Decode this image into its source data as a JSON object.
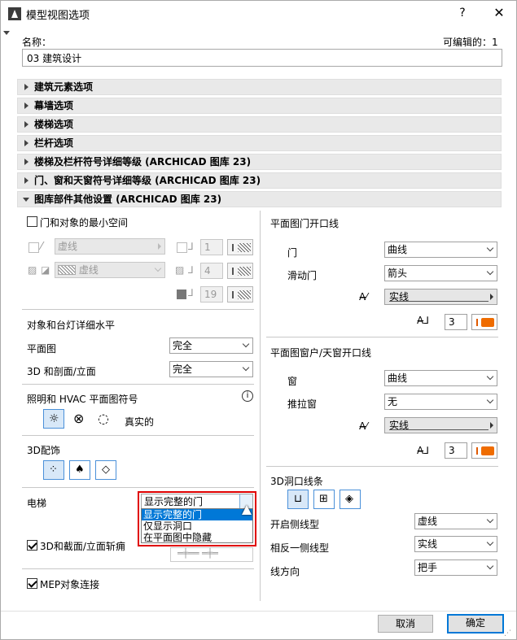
{
  "window": {
    "title": "模型视图选项",
    "help": "?",
    "close": "✕"
  },
  "header": {
    "name_label": "名称：",
    "editable_label": "可编辑的：1",
    "name_value": "03 建筑设计"
  },
  "panels": [
    {
      "label": "建筑元素选项",
      "expanded": false
    },
    {
      "label": "幕墙选项",
      "expanded": false
    },
    {
      "label": "楼梯选项",
      "expanded": false
    },
    {
      "label": "栏杆选项",
      "expanded": false
    },
    {
      "label": "楼梯及栏杆符号详细等级 (ARCHICAD 图库 23)",
      "expanded": false
    },
    {
      "label": "门、窗和天窗符号详细等级 (ARCHICAD 图库 23)",
      "expanded": false
    },
    {
      "label": "图库部件其他设置 (ARCHICAD 图库 23)",
      "expanded": true
    }
  ],
  "left": {
    "min_space": {
      "label": "门和对象的最小空间",
      "checked": false
    },
    "row1": {
      "line": "虚线",
      "num": "1"
    },
    "row2": {
      "line": "虚线",
      "num": "4"
    },
    "row3": {
      "num": "19"
    },
    "detail_level": {
      "title": "对象和台灯详细水平",
      "plan_label": "平面图",
      "plan_value": "完全",
      "section_label": "3D 和剖面/立面",
      "section_value": "完全"
    },
    "lighting": {
      "title": "照明和 HVAC 平面图符号",
      "info": "i",
      "real_label": "真实的"
    },
    "deco": {
      "title": "3D配饰"
    },
    "elevator": {
      "label": "电梯",
      "value": "显示完整的门",
      "options": [
        "显示完整的门",
        "仅显示洞口",
        "在平面图中隐藏"
      ],
      "highlighted": 0
    },
    "cut": {
      "label": "3D和截面/立面斩痈",
      "checked": true
    },
    "mep": {
      "label": "MEP对象连接",
      "checked": true
    }
  },
  "right": {
    "door_open": {
      "title": "平面图门开口线",
      "door_label": "门",
      "door_value": "曲线",
      "sliding_label": "滑动门",
      "sliding_value": "箭头",
      "line_value": "实线",
      "pen": "3"
    },
    "window_open": {
      "title": "平面图窗户/天窗开口线",
      "window_label": "窗",
      "window_value": "曲线",
      "slide_label": "推拉窗",
      "slide_value": "无",
      "line_value": "实线",
      "pen": "3"
    },
    "opening_lines": {
      "title": "3D洞口线条",
      "open_side_label": "开启侧线型",
      "open_side_value": "虚线",
      "opposite_label": "相反一侧线型",
      "opposite_value": "实线",
      "direction_label": "线方向",
      "direction_value": "把手"
    }
  },
  "footer": {
    "cancel": "取消",
    "ok": "确定"
  },
  "colors": {
    "accent": "#0078d7",
    "highlight_frame": "#e00000",
    "pen_orange": "#ef6c00"
  }
}
